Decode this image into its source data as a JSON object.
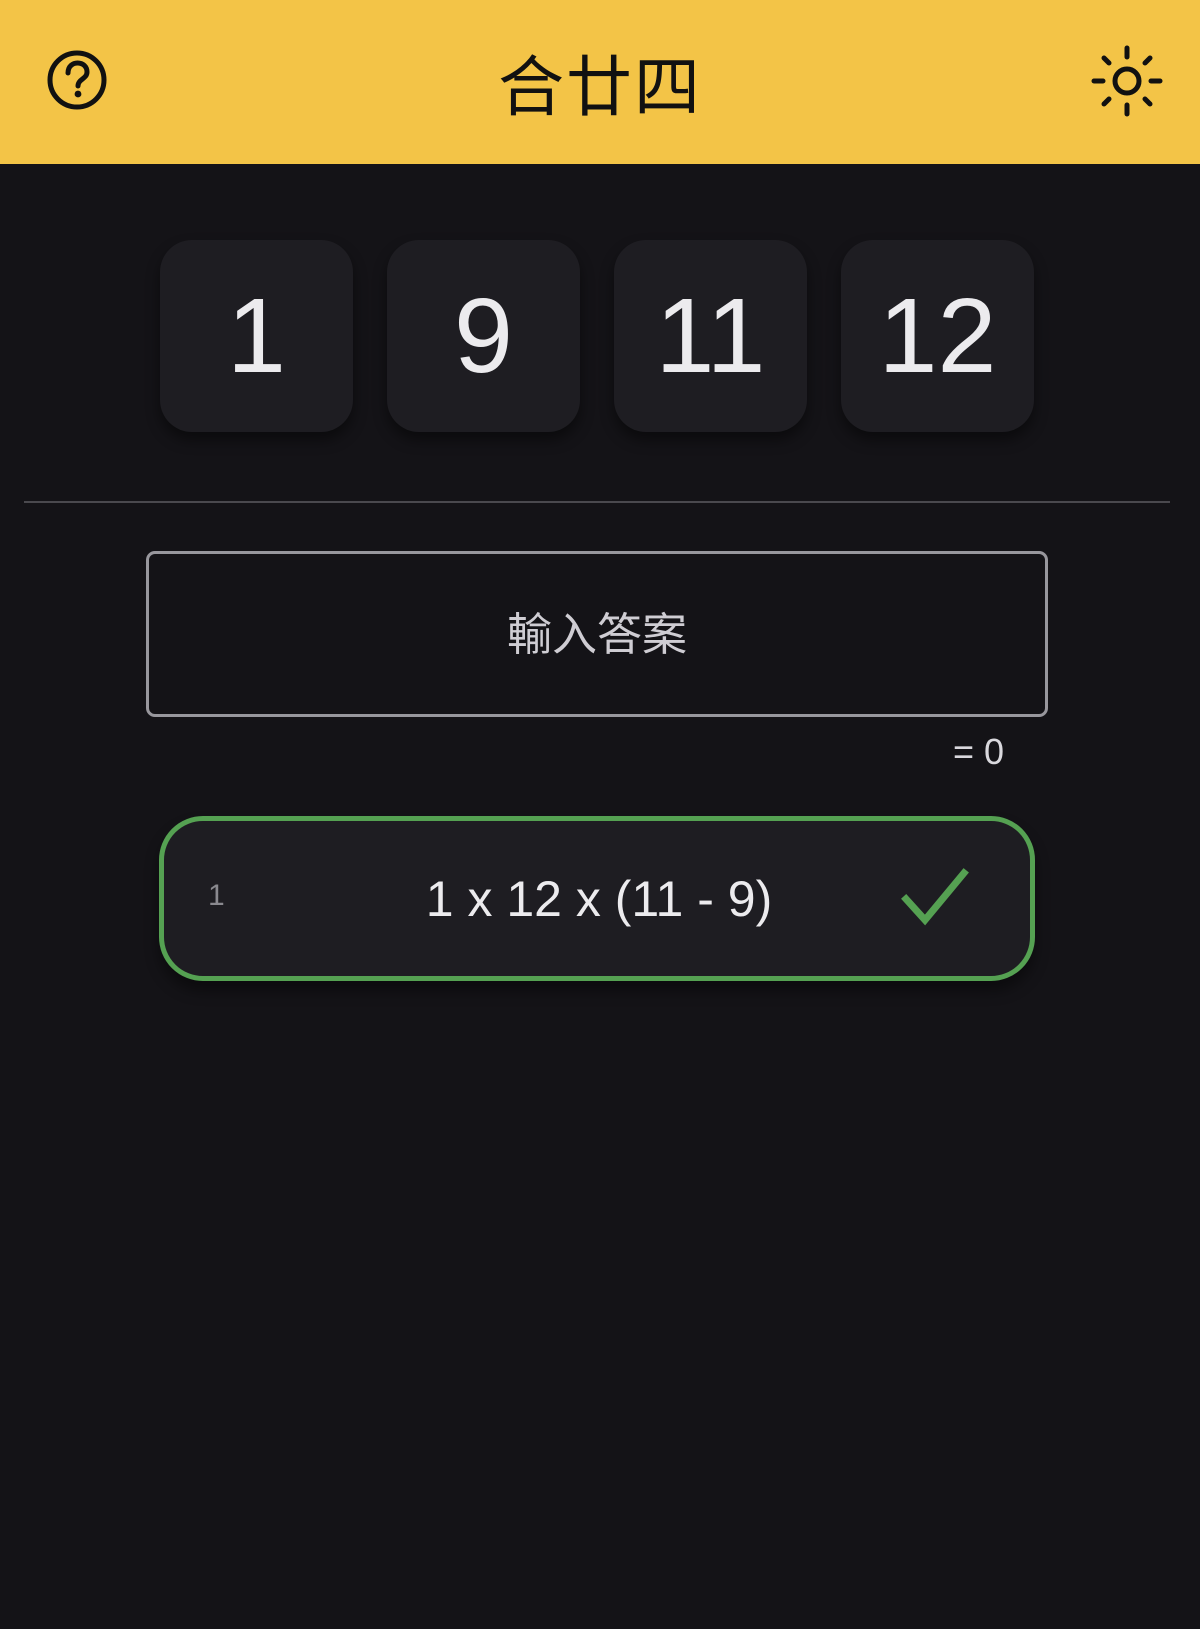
{
  "app": {
    "title": "合廿四",
    "accent_color": "#f3c447",
    "background_color": "#141317"
  },
  "header": {
    "help_icon": "help-circle-icon",
    "theme_icon": "sun-icon"
  },
  "numbers": [
    "1",
    "9",
    "11",
    "12"
  ],
  "answer": {
    "value": "",
    "placeholder": "輸入答案",
    "result_text": "= 0"
  },
  "solutions": [
    {
      "index": "1",
      "expression": "1 x 12 x (11 - 9)",
      "status_icon": "check-icon",
      "status_color": "#55a152"
    }
  ]
}
